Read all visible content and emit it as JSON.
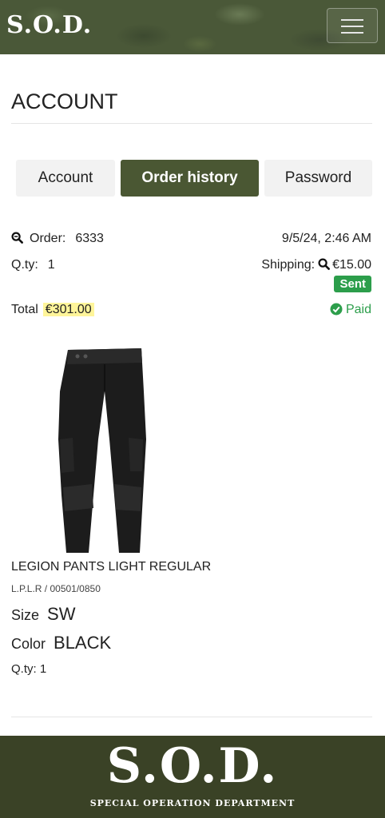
{
  "header": {
    "logo": "S.O.D."
  },
  "page": {
    "title": "ACCOUNT"
  },
  "tabs": [
    {
      "label": "Account",
      "active": false
    },
    {
      "label": "Order history",
      "active": true
    },
    {
      "label": "Password",
      "active": false
    }
  ],
  "order": {
    "order_label": "Order:",
    "order_number": "6333",
    "datetime": "9/5/24, 2:46 AM",
    "qty_label": "Q.ty:",
    "qty": "1",
    "shipping_label": "Shipping:",
    "shipping_amount": "€15.00",
    "status_badge": "Sent",
    "total_label": "Total",
    "total_amount": "€301.00",
    "payment_status": "Paid"
  },
  "product": {
    "name": "LEGION PANTS LIGHT REGULAR",
    "code": "L.P.L.R / 00501/0850",
    "size_label": "Size",
    "size_value": "SW",
    "color_label": "Color",
    "color_value": "BLACK",
    "qty_text": "Q.ty: 1"
  },
  "footer": {
    "logo": "S.O.D.",
    "tagline": "SPECIAL OPERATION DEPARTMENT"
  },
  "colors": {
    "accent": "#4a5733",
    "footer_bg": "#3a4226",
    "success": "#2c9e4b",
    "highlight": "#fff59a"
  }
}
